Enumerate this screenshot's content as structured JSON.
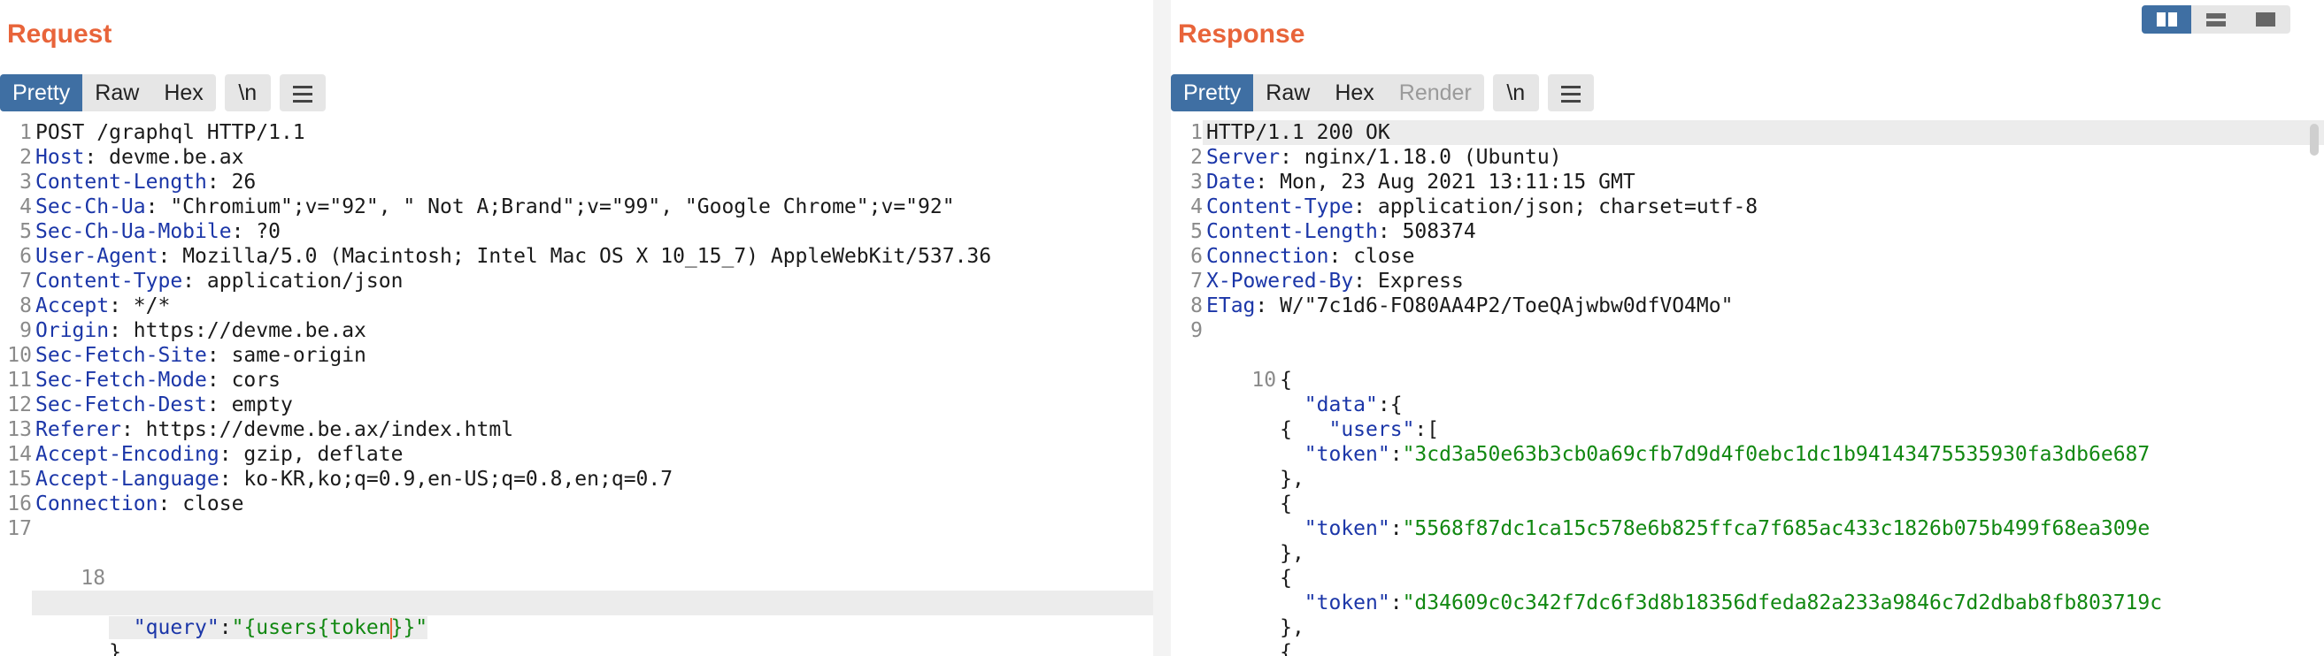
{
  "request": {
    "title": "Request",
    "tabs": {
      "pretty": "Pretty",
      "raw": "Raw",
      "hex": "Hex"
    },
    "newline_label": "\\n",
    "lines": [
      {
        "n": "1",
        "name": "",
        "value": "POST /graphql HTTP/1.1"
      },
      {
        "n": "2",
        "name": "Host",
        "value": " devme.be.ax"
      },
      {
        "n": "3",
        "name": "Content-Length",
        "value": " 26"
      },
      {
        "n": "4",
        "name": "Sec-Ch-Ua",
        "value": " \"Chromium\";v=\"92\", \" Not A;Brand\";v=\"99\", \"Google Chrome\";v=\"92\""
      },
      {
        "n": "5",
        "name": "Sec-Ch-Ua-Mobile",
        "value": " ?0"
      },
      {
        "n": "6",
        "name": "User-Agent",
        "value": " Mozilla/5.0 (Macintosh; Intel Mac OS X 10_15_7) AppleWebKit/537.36"
      },
      {
        "n": "7",
        "name": "Content-Type",
        "value": " application/json"
      },
      {
        "n": "8",
        "name": "Accept",
        "value": " */*"
      },
      {
        "n": "9",
        "name": "Origin",
        "value": " https://devme.be.ax"
      },
      {
        "n": "10",
        "name": "Sec-Fetch-Site",
        "value": " same-origin"
      },
      {
        "n": "11",
        "name": "Sec-Fetch-Mode",
        "value": " cors"
      },
      {
        "n": "12",
        "name": "Sec-Fetch-Dest",
        "value": " empty"
      },
      {
        "n": "13",
        "name": "Referer",
        "value": " https://devme.be.ax/index.html"
      },
      {
        "n": "14",
        "name": "Accept-Encoding",
        "value": " gzip, deflate"
      },
      {
        "n": "15",
        "name": "Accept-Language",
        "value": " ko-KR,ko;q=0.9,en-US;q=0.8,en;q=0.7"
      },
      {
        "n": "16",
        "name": "Connection",
        "value": " close"
      },
      {
        "n": "17",
        "name": "",
        "value": ""
      }
    ],
    "body_line_number": "18",
    "body_open": "{",
    "body_key": "\"query\"",
    "body_colon": ":",
    "body_value_before_cursor": "\"{users{token",
    "body_value_after_cursor": "}}\"",
    "body_close": "}"
  },
  "response": {
    "title": "Response",
    "tabs": {
      "pretty": "Pretty",
      "raw": "Raw",
      "hex": "Hex",
      "render": "Render"
    },
    "newline_label": "\\n",
    "lines": [
      {
        "n": "1",
        "name": "",
        "value": "HTTP/1.1 200 OK"
      },
      {
        "n": "2",
        "name": "Server",
        "value": " nginx/1.18.0 (Ubuntu)"
      },
      {
        "n": "3",
        "name": "Date",
        "value": " Mon, 23 Aug 2021 13:11:15 GMT"
      },
      {
        "n": "4",
        "name": "Content-Type",
        "value": " application/json; charset=utf-8"
      },
      {
        "n": "5",
        "name": "Content-Length",
        "value": " 508374"
      },
      {
        "n": "6",
        "name": "Connection",
        "value": " close"
      },
      {
        "n": "7",
        "name": "X-Powered-By",
        "value": " Express"
      },
      {
        "n": "8",
        "name": "ETag",
        "value": " W/\"7c1d6-FO80AA4P2/ToeQAjwbw0dfVO4Mo\""
      },
      {
        "n": "9",
        "name": "",
        "value": ""
      }
    ],
    "body_line_number": "10",
    "json": {
      "open": "{",
      "data_key": "\"data\"",
      "data_open": ":{",
      "users_key": "\"users\"",
      "users_open": ":[",
      "token_key": "\"token\"",
      "colon": ":",
      "obj_open": "{",
      "obj_close": "},",
      "tokens": [
        "\"3cd3a50e63b3cb0a69cfb7d9d4f0ebc1dc1b94143475535930fa3db6e687",
        "\"5568f87dc1ca15c578e6b825ffca7f685ac433c1826b075b499f68ea309e",
        "\"d34609c0c342f7dc6f3d8b18356dfeda82a233a9846c7d2dbab8fb803719c"
      ]
    }
  },
  "layout_buttons": [
    "side-by-side",
    "stacked",
    "single"
  ],
  "colors": {
    "accent": "#e8643a",
    "active_tab": "#3f6fa3",
    "header_name": "#1b36a8",
    "json_string": "#118811"
  }
}
